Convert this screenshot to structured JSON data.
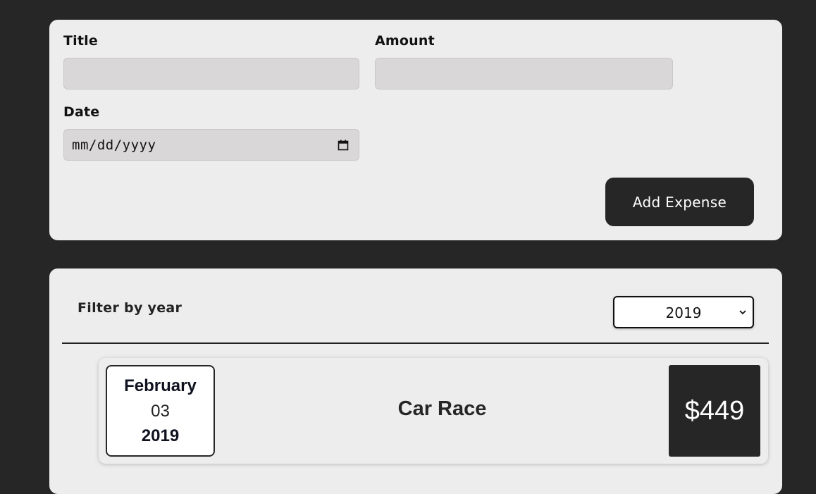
{
  "form": {
    "title_label": "Title",
    "title_value": "",
    "amount_label": "Amount",
    "amount_value": "",
    "date_label": "Date",
    "date_placeholder": "mm/dd/yyyy",
    "add_button_label": "Add Expense"
  },
  "filter": {
    "label": "Filter by year",
    "selected_year": "2019"
  },
  "expenses": [
    {
      "month": "February",
      "day": "03",
      "year": "2019",
      "title": "Car Race",
      "amount": "$449"
    }
  ],
  "colors": {
    "background": "#262626",
    "card": "#ededed",
    "input": "#d9d7d8",
    "button": "#262626",
    "button_text": "#ffffff"
  },
  "icons": {
    "date_field": "calendar-icon",
    "year_select": "chevron-down-icon"
  }
}
